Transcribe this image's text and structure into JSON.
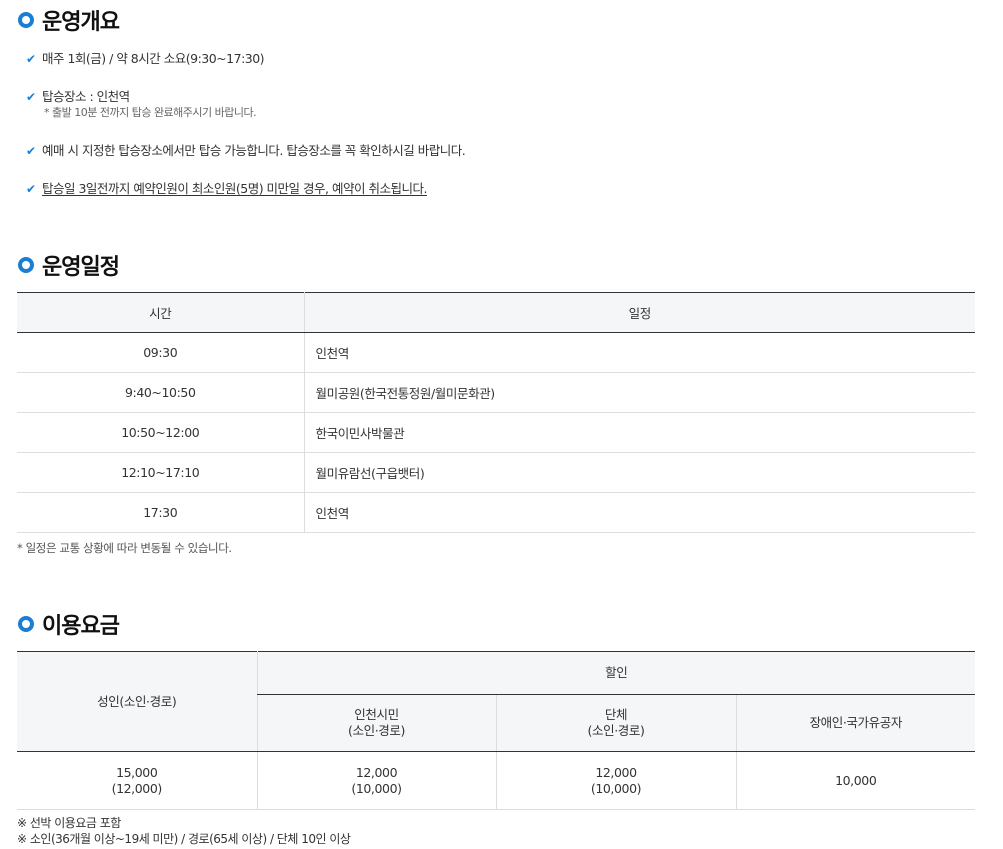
{
  "overview": {
    "title": "운영개요",
    "items": [
      {
        "text": "매주 1회(금) / 약 8시간 소요(9:30~17:30)",
        "sub": ""
      },
      {
        "text": "탑승장소 : 인천역",
        "sub": "* 출발 10분 전까지 탑승 완료해주시기 바랍니다."
      },
      {
        "text": "예매 시 지정한 탑승장소에서만 탑승 가능합니다. 탑승장소를 꼭 확인하시길 바랍니다.",
        "sub": ""
      },
      {
        "text": "탑승일 3일전까지 예약인원이 최소인원(5명) 미만일 경우, 예약이 취소됩니다.",
        "sub": ""
      }
    ]
  },
  "schedule": {
    "title": "운영일정",
    "headers": {
      "time": "시간",
      "plan": "일정"
    },
    "rows": [
      {
        "time": "09:30",
        "plan": "인천역"
      },
      {
        "time": "9:40~10:50",
        "plan": "월미공원(한국전통정원/월미문화관)"
      },
      {
        "time": "10:50~12:00",
        "plan": "한국이민사박물관"
      },
      {
        "time": "12:10~17:10",
        "plan": "월미유람선(구읍뱃터)"
      },
      {
        "time": "17:30",
        "plan": "인천역"
      }
    ],
    "note": "* 일정은 교통 상황에 따라 변동될 수 있습니다."
  },
  "fees": {
    "title": "이용요금",
    "headers": {
      "adult": "성인(소인·경로)",
      "discount": "할인",
      "incheon_line1": "인천시민",
      "incheon_line2": "(소인·경로)",
      "group_line1": "단체",
      "group_line2": "(소인·경로)",
      "disabled": "장애인·국가유공자"
    },
    "row": {
      "adult_main": "15,000",
      "adult_sub": "(12,000)",
      "incheon_main": "12,000",
      "incheon_sub": "(10,000)",
      "group_main": "12,000",
      "group_sub": "(10,000)",
      "disabled": "10,000"
    },
    "notes": [
      "※ 선박 이용요금 포함",
      "※ 소인(36개월 이상~19세 미만) / 경로(65세 이상) / 단체 10인 이상"
    ]
  },
  "colors": {
    "accent": "#1a7fd4",
    "header_bg": "#f5f6f8"
  },
  "icons": {
    "section_marker": "ring-icon",
    "bullet": "check-icon"
  }
}
